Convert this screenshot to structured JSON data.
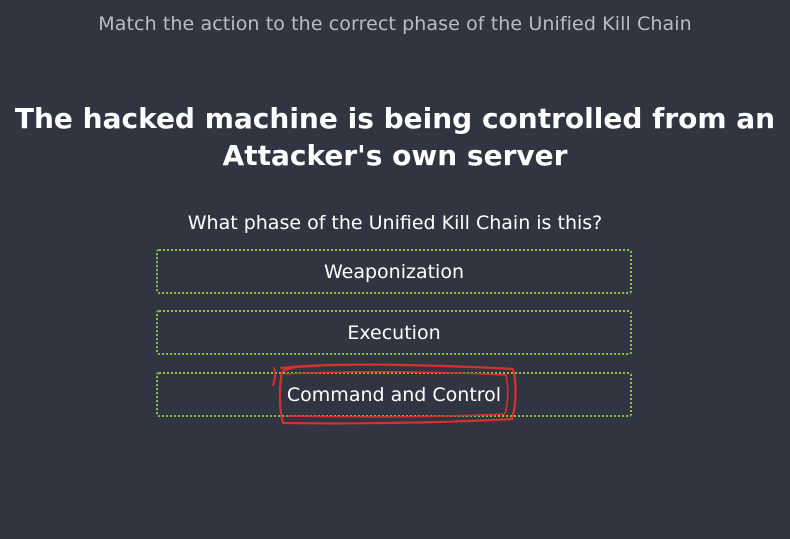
{
  "quiz": {
    "instruction": "Match the action to the correct phase of the Unified Kill Chain",
    "statement": "The hacked machine is being controlled from an Attacker's own server",
    "question": "What phase of the Unified Kill Chain is this?",
    "options": [
      {
        "label": "Weaponization"
      },
      {
        "label": "Execution"
      },
      {
        "label": "Command and Control"
      }
    ]
  },
  "colors": {
    "background": "#313542",
    "option_border": "#8bc43f",
    "annotation_stroke": "#d6312d"
  }
}
